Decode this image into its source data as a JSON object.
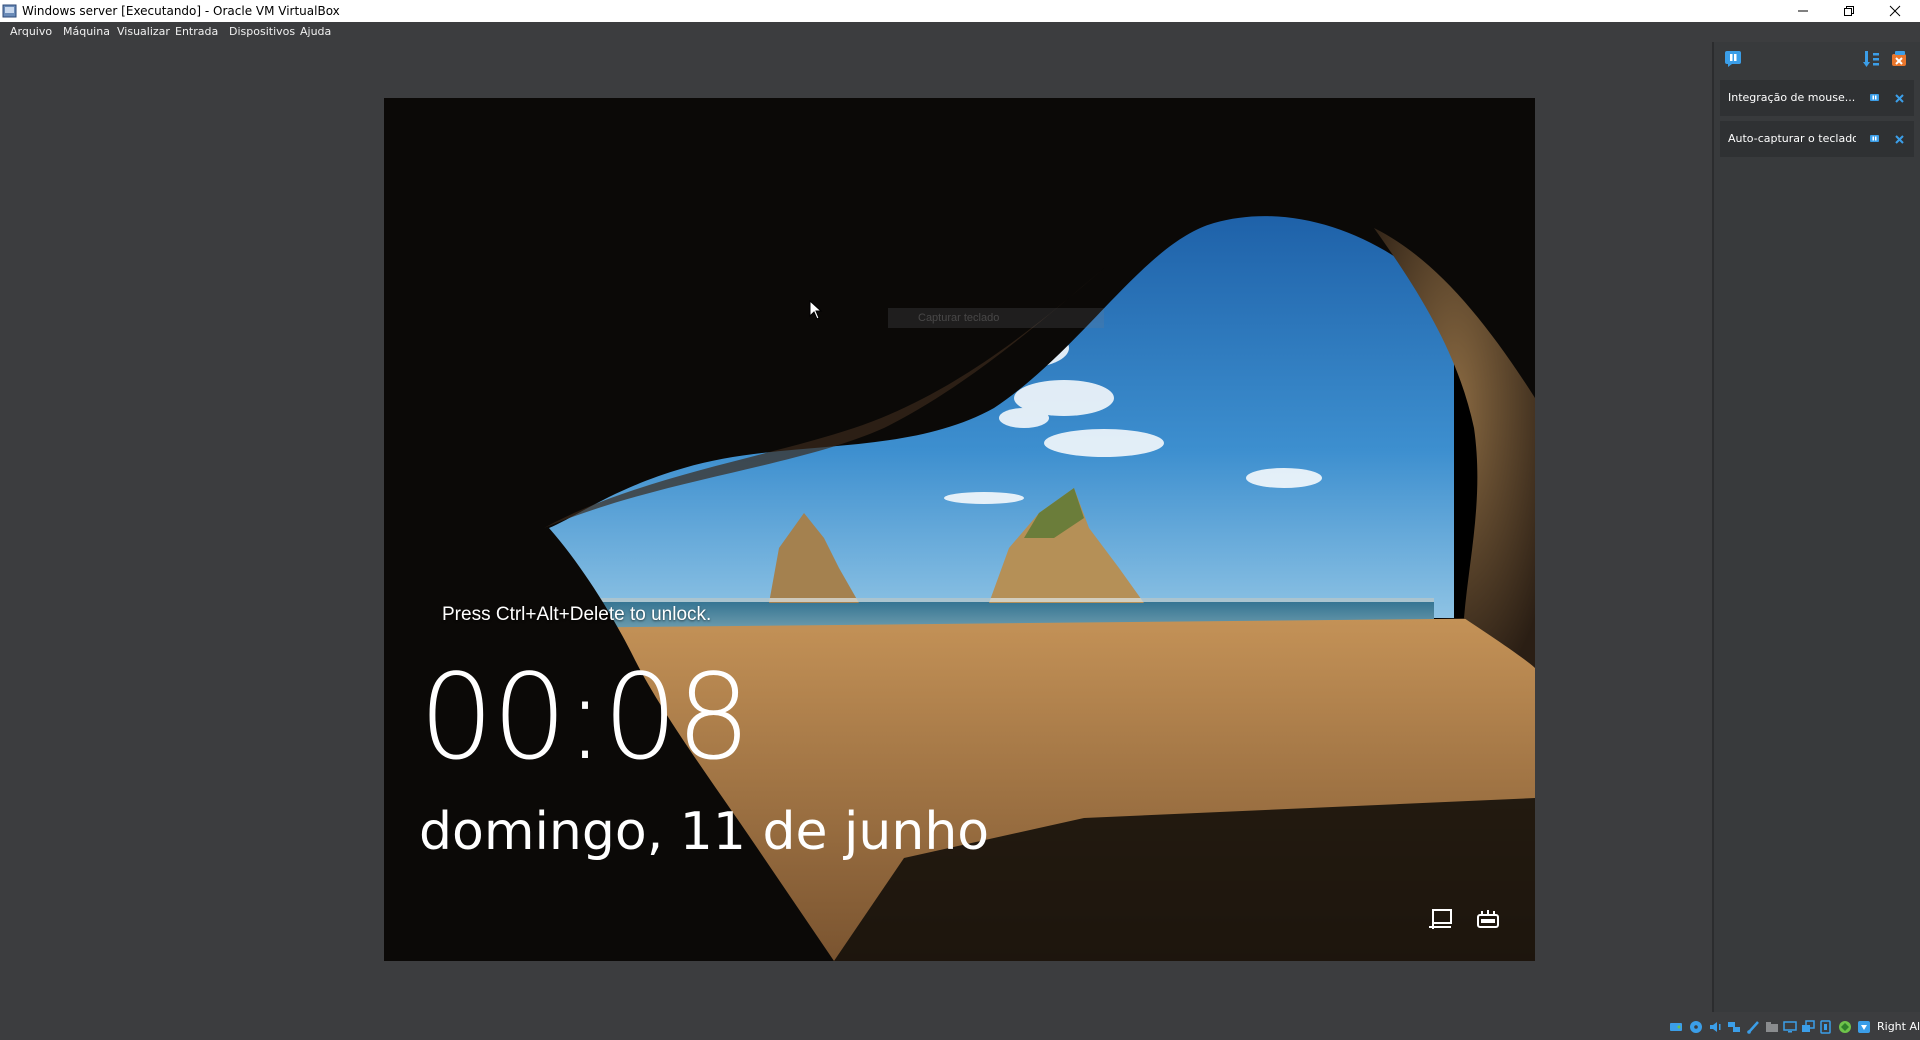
{
  "window": {
    "title": "Windows server [Executando] - Oracle VM VirtualBox",
    "icons": {
      "app": "virtualbox-icon",
      "minimize": "minimize-icon",
      "restore": "restore-icon",
      "close": "close-icon"
    }
  },
  "menu": {
    "items": [
      "Arquivo",
      "Máquina",
      "Visualizar",
      "Entrada",
      "Dispositivos",
      "Ajuda"
    ]
  },
  "vm": {
    "lock_hint": "Press Ctrl+Alt+Delete to unlock.",
    "time": "00:08",
    "date": "domingo, 11 de junho",
    "ghost_popup": "Capturar teclado",
    "icons": [
      "network-icon",
      "accessibility-icon"
    ],
    "colors": {
      "sky": "#2a6fb8",
      "sand": "#b07d43",
      "cave": "#0c0a08"
    }
  },
  "side_panel": {
    "toolbar_icons": [
      "notifications-icon",
      "sort-icon",
      "close-all-icon"
    ],
    "notices": [
      {
        "text": "Integração de mouse...",
        "pin_icon": "pin-icon",
        "close_icon": "close-icon"
      },
      {
        "text": "Auto-capturar o teclado...",
        "pin_icon": "pin-icon",
        "close_icon": "close-icon"
      }
    ],
    "accent": "#3b9ee8"
  },
  "status_bar": {
    "icons": [
      "hard-disk-icon",
      "optical-disk-icon",
      "audio-icon",
      "network-icon",
      "usb-icon",
      "shared-folders-icon",
      "display-icon",
      "recording-icon",
      "video-capture-icon",
      "cpu-icon",
      "guest-additions-icon",
      "mouse-integration-icon"
    ],
    "host_key": "Right Alt"
  }
}
